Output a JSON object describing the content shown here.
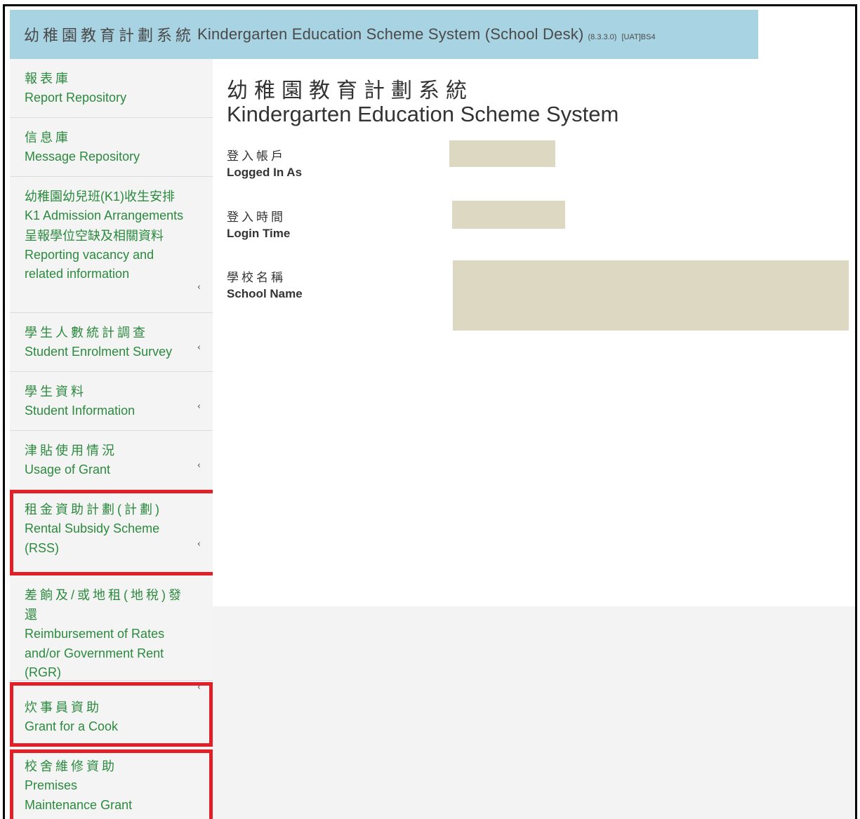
{
  "header": {
    "title_zh": "幼稚園教育計劃系統",
    "title_en": "Kindergarten Education Scheme System (School Desk)",
    "version": "(8.3.3.0)",
    "environment": "[UAT]BS4"
  },
  "sidebar": {
    "items": [
      {
        "zh": "報表庫",
        "en": "Report Repository",
        "has_submenu": false,
        "highlighted": false
      },
      {
        "zh": "信息庫",
        "en": "Message Repository",
        "has_submenu": false,
        "highlighted": false
      },
      {
        "zh": "幼稚園幼兒班(K1)收生安排",
        "en": "K1 Admission Arrangements",
        "zh2": "呈報學位空缺及相關資料",
        "en2": "Reporting vacancy and related information",
        "has_submenu": true,
        "highlighted": false
      },
      {
        "zh": "學生人數統計調查",
        "en": "Student Enrolment Survey",
        "has_submenu": true,
        "highlighted": false
      },
      {
        "zh": "學生資料",
        "en": "Student Information",
        "has_submenu": true,
        "highlighted": false
      },
      {
        "zh": "津貼使用情況",
        "en": "Usage of Grant",
        "has_submenu": true,
        "highlighted": false
      },
      {
        "zh": "租金資助計劃(計劃)",
        "en": "Rental Subsidy Scheme (RSS)",
        "has_submenu": true,
        "highlighted": true
      },
      {
        "zh": "差餉及/或地租(地稅)發還",
        "en": "Reimbursement of Rates and/or Government Rent (RGR)",
        "has_submenu": true,
        "highlighted": false
      },
      {
        "zh": "炊事員資助",
        "en": "Grant for a Cook",
        "has_submenu": false,
        "highlighted": true
      },
      {
        "zh": "校舍維修資助",
        "en": "Premises Maintenance Grant",
        "has_submenu": false,
        "highlighted": true
      }
    ],
    "chevron_glyph": "‹",
    "highlight_color": "#e21f26",
    "link_color": "#2b8a3e"
  },
  "main": {
    "title_zh": "幼稚園教育計劃系統",
    "title_en": "Kindergarten Education Scheme System",
    "fields": [
      {
        "label_zh": "登入帳戶",
        "label_en": "Logged In As",
        "value": ""
      },
      {
        "label_zh": "登入時間",
        "label_en": "Login Time",
        "value": ""
      },
      {
        "label_zh": "學校名稱",
        "label_en": "School Name",
        "value": ""
      }
    ],
    "redaction_color": "#ddd8c2"
  }
}
